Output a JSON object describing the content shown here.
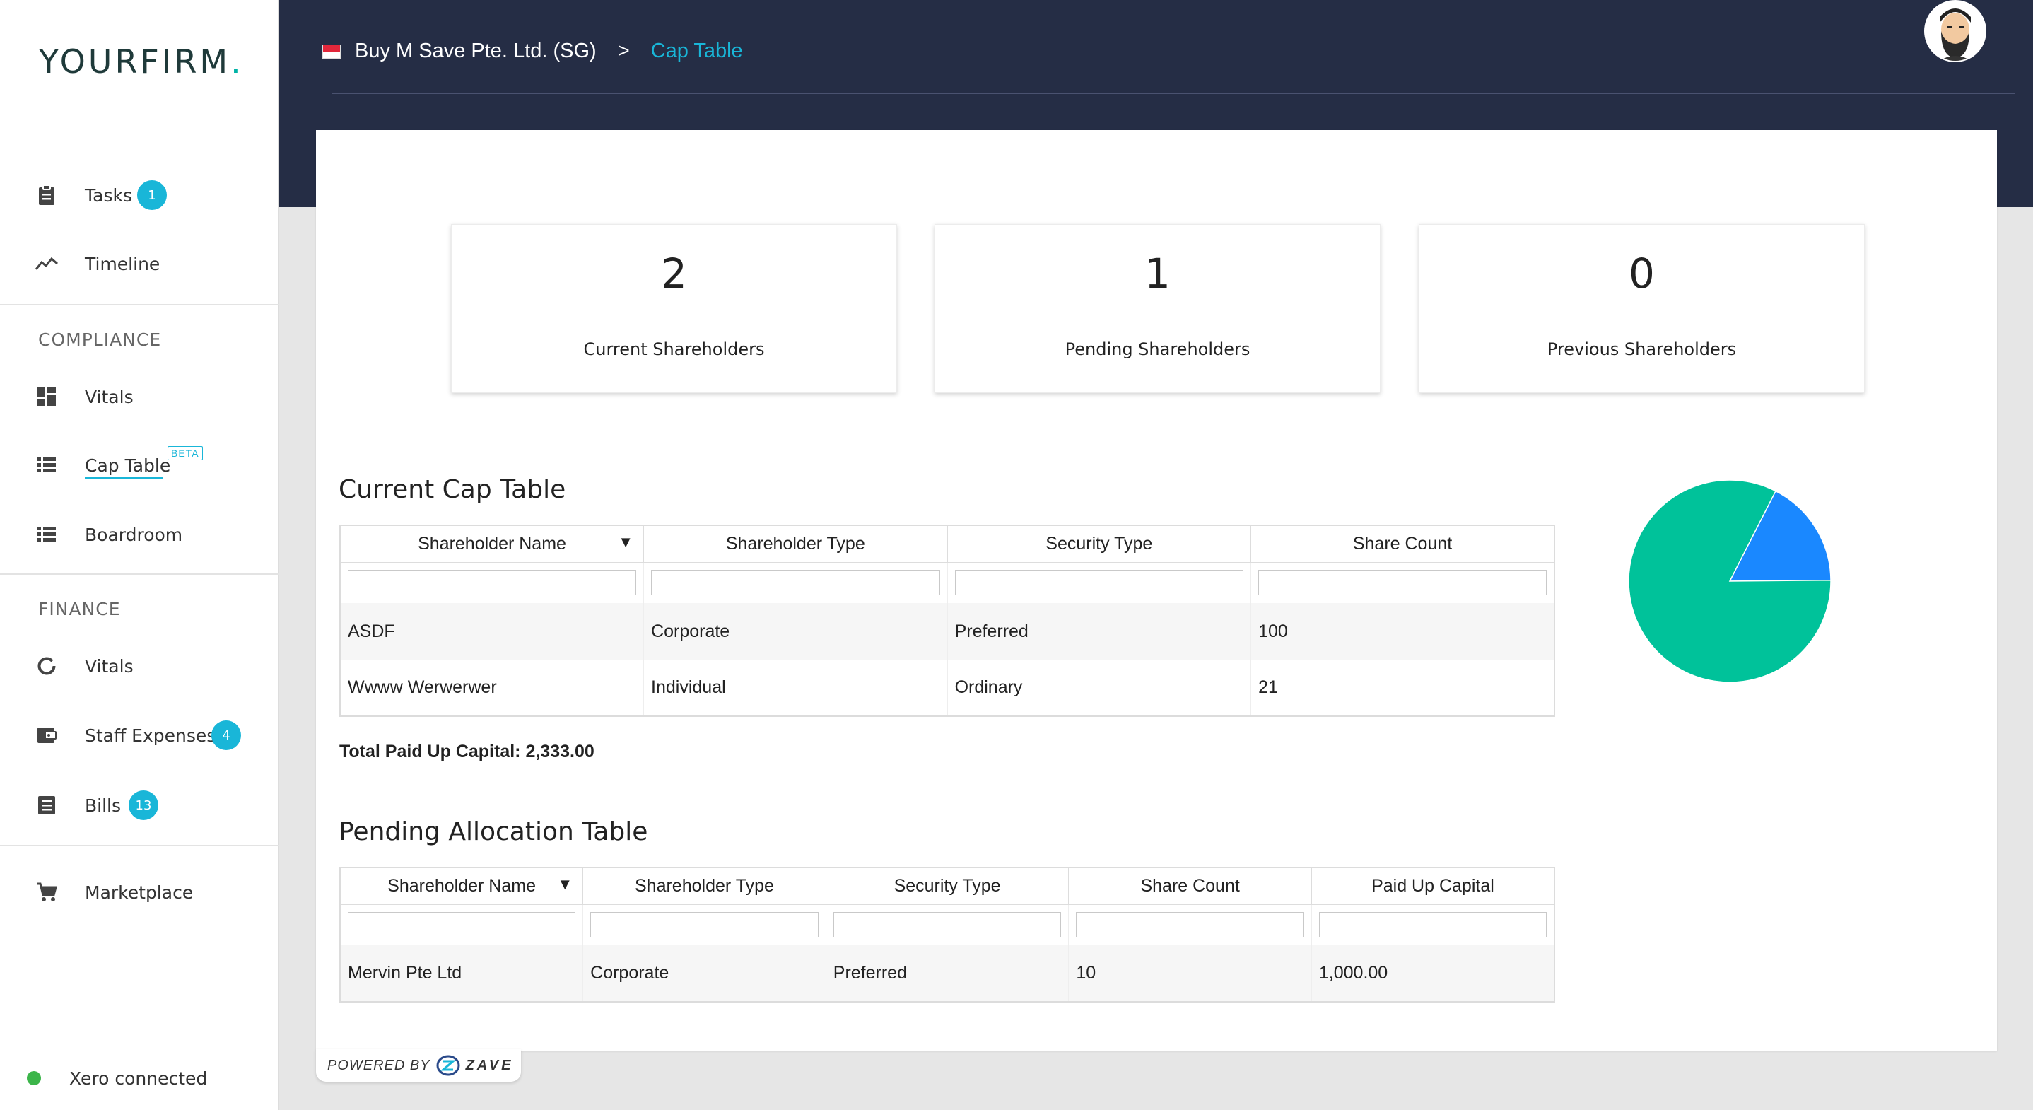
{
  "brand": {
    "name": "YOURFIRM",
    "dot": "."
  },
  "sidebar": {
    "tasks": {
      "label": "Tasks",
      "badge": "1"
    },
    "timeline": {
      "label": "Timeline"
    },
    "compliance_title": "COMPLIANCE",
    "compliance_vitals": {
      "label": "Vitals"
    },
    "cap_table": {
      "label": "Cap Table",
      "tag": "BETA"
    },
    "boardroom": {
      "label": "Boardroom"
    },
    "finance_title": "FINANCE",
    "finance_vitals": {
      "label": "Vitals"
    },
    "staff_expenses": {
      "label": "Staff Expenses",
      "badge": "4"
    },
    "bills": {
      "label": "Bills",
      "badge": "13"
    },
    "marketplace": {
      "label": "Marketplace"
    },
    "xero_status": "Xero connected"
  },
  "header": {
    "company": "Buy M Save Pte. Ltd. (SG)",
    "separator": ">",
    "current": "Cap Table"
  },
  "stats": [
    {
      "value": "2",
      "label": "Current Shareholders"
    },
    {
      "value": "1",
      "label": "Pending Shareholders"
    },
    {
      "value": "0",
      "label": "Previous Shareholders"
    }
  ],
  "current_table": {
    "title": "Current Cap Table",
    "columns": [
      "Shareholder Name",
      "Shareholder Type",
      "Security Type",
      "Share Count"
    ],
    "sort_indicator": "▼",
    "rows": [
      [
        "ASDF",
        "Corporate",
        "Preferred",
        "100"
      ],
      [
        "Wwww Werwerwer",
        "Individual",
        "Ordinary",
        "21"
      ]
    ],
    "total_label": "Total Paid Up Capital: 2,333.00"
  },
  "pending_table": {
    "title": "Pending Allocation Table",
    "columns": [
      "Shareholder Name",
      "Shareholder Type",
      "Security Type",
      "Share Count",
      "Paid Up Capital"
    ],
    "sort_indicator": "▼",
    "rows": [
      [
        "Mervin Pte Ltd",
        "Corporate",
        "Preferred",
        "10",
        "1,000.00"
      ]
    ]
  },
  "chart_data": {
    "type": "pie",
    "categories": [
      "ASDF",
      "Wwww Werwerwer"
    ],
    "values": [
      100,
      21
    ],
    "colors": [
      "#00c29a",
      "#1a88ff"
    ]
  },
  "footer": {
    "powered_by": "POWERED BY",
    "vendor": "ZAVE"
  },
  "colors": {
    "accent": "#19b6d8",
    "header_bg": "#252d45"
  }
}
